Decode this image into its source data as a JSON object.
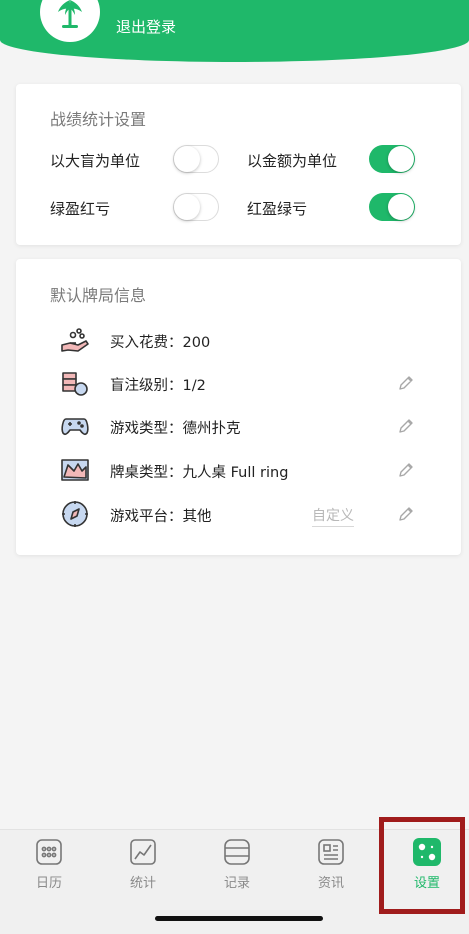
{
  "header": {
    "logout_label": "退出登录",
    "color": "#1fb86a"
  },
  "stats_settings": {
    "title": "战绩统计设置",
    "options": [
      {
        "label": "以大盲为单位",
        "on": false
      },
      {
        "label": "以金额为单位",
        "on": true
      },
      {
        "label": "绿盈红亏",
        "on": false
      },
      {
        "label": "红盈绿亏",
        "on": true
      }
    ]
  },
  "default_info": {
    "title": "默认牌局信息",
    "rows": [
      {
        "icon": "buy-in-icon",
        "text": "买入花费：200",
        "editable": false
      },
      {
        "icon": "blinds-icon",
        "text": "盲注级别：1/2",
        "editable": true
      },
      {
        "icon": "gamepad-icon",
        "text": "游戏类型：德州扑克",
        "editable": true
      },
      {
        "icon": "table-icon",
        "text": "牌桌类型：九人桌 Full ring",
        "editable": true
      },
      {
        "icon": "compass-icon",
        "text": "游戏平台：其他",
        "editable": true,
        "custom_label": "自定义"
      }
    ]
  },
  "tabs": [
    {
      "label": "日历",
      "icon": "calendar-icon",
      "active": false
    },
    {
      "label": "统计",
      "icon": "chart-icon",
      "active": false
    },
    {
      "label": "记录",
      "icon": "records-icon",
      "active": false
    },
    {
      "label": "资讯",
      "icon": "news-icon",
      "active": false
    },
    {
      "label": "设置",
      "icon": "settings-icon",
      "active": true
    }
  ],
  "colors": {
    "accent": "#1fb86a",
    "highlight_box": "#a01c1c"
  }
}
